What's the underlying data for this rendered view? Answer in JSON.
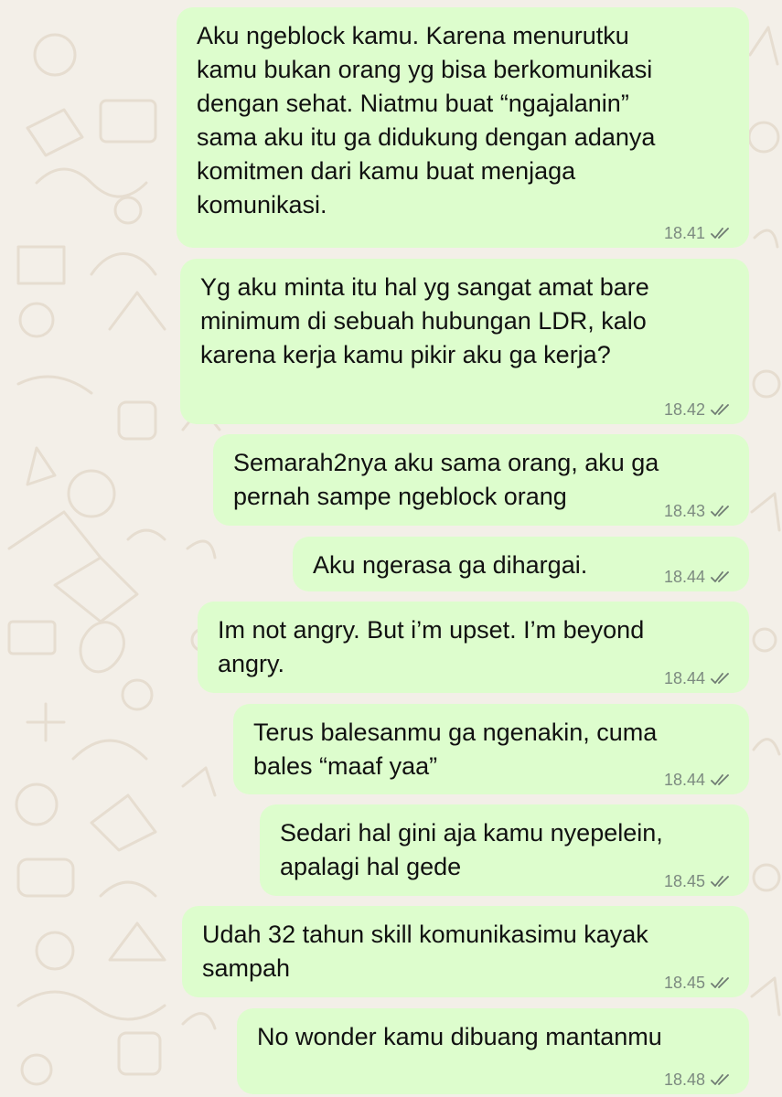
{
  "chat": {
    "messages": [
      {
        "text": "Aku ngeblock kamu. Karena menurutku\nkamu bukan orang yg bisa berkomunikasi\ndengan sehat. Niatmu buat “ngajalanin”\nsama aku itu ga didukung dengan adanya\nkomitmen dari kamu buat menjaga\nkomunikasi.",
        "time": "18.41",
        "status": "read"
      },
      {
        "text": "Yg aku minta itu hal yg sangat amat bare\nminimum di sebuah hubungan LDR, kalo\nkarena kerja kamu pikir aku ga kerja?",
        "time": "18.42",
        "status": "read"
      },
      {
        "text": "Semarah2nya aku sama orang, aku ga\npernah sampe ngeblock orang",
        "time": "18.43",
        "status": "read"
      },
      {
        "text": "Aku ngerasa ga dihargai.",
        "time": "18.44",
        "status": "read"
      },
      {
        "text": "Im not angry. But i’m upset. I’m beyond\nangry.",
        "time": "18.44",
        "status": "read"
      },
      {
        "text": "Terus balesanmu ga ngenakin, cuma\nbales “maaf yaa”",
        "time": "18.44",
        "status": "read"
      },
      {
        "text": "Sedari hal gini aja kamu nyepelein,\napalagi hal gede",
        "time": "18.45",
        "status": "read"
      },
      {
        "text": "Udah 32 tahun skill komunikasimu kayak\nsampah",
        "time": "18.45",
        "status": "read"
      },
      {
        "text": "No wonder kamu dibuang mantanmu",
        "time": "18.48",
        "status": "read"
      }
    ]
  },
  "colors": {
    "background": "#f3efe8",
    "outgoing_bubble": "#ddfdcd",
    "timestamp": "#7c8a80",
    "tick": "#6f7b73",
    "doodle": "#e6ddd0"
  },
  "icons": {
    "status_read": "double-check-icon",
    "wallpaper": "doodle-pattern"
  }
}
